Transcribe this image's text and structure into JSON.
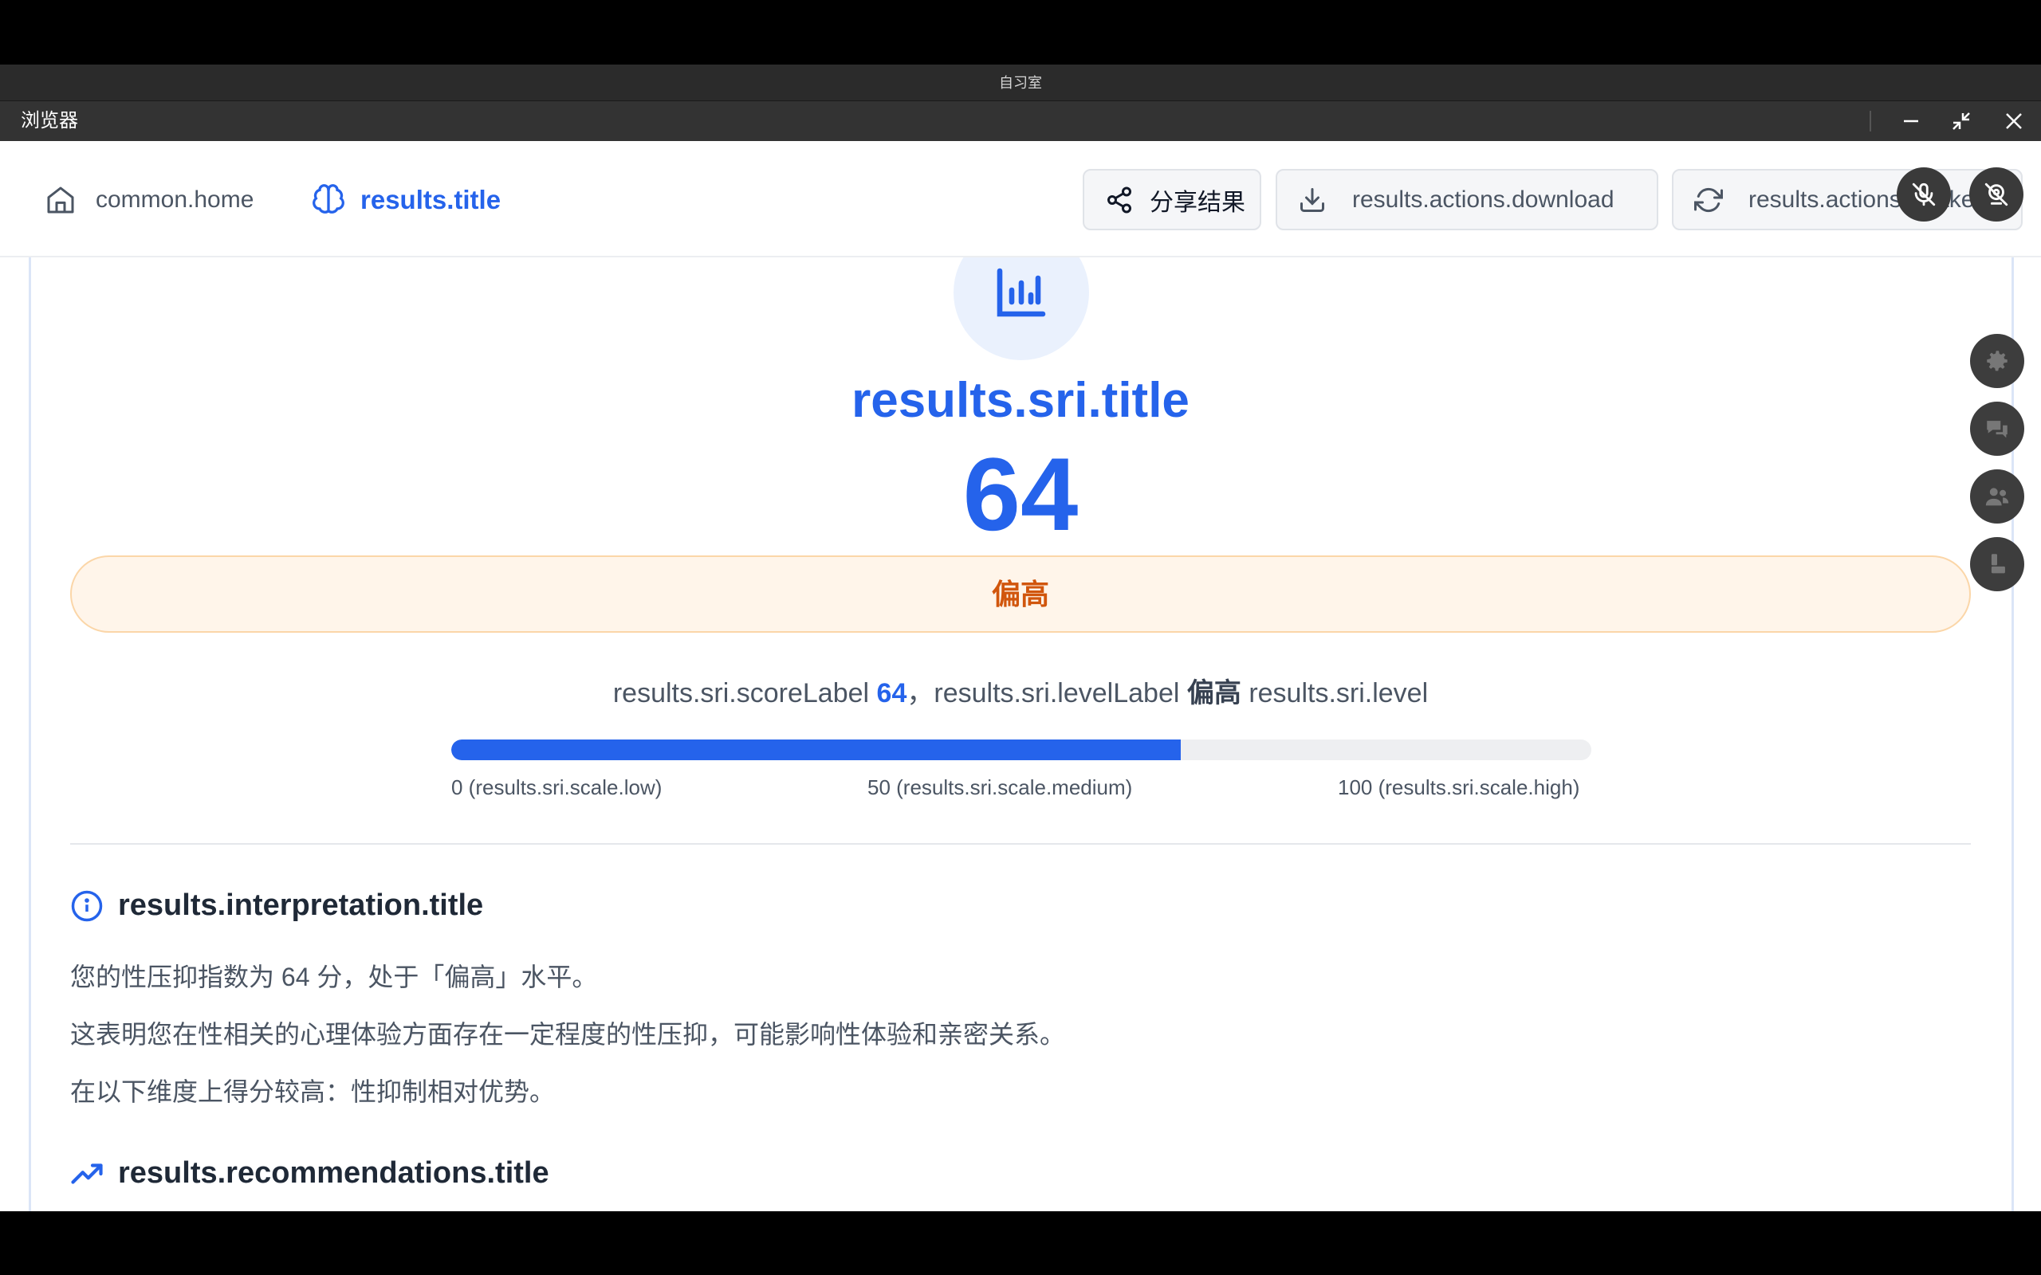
{
  "os": {
    "window_title": "自习室"
  },
  "window": {
    "app_name": "浏览器"
  },
  "nav": {
    "home_label": "common.home",
    "results_label": "results.title",
    "share_label": "分享结果",
    "download_label": "results.actions.download",
    "retake_label": "results.actions.retake"
  },
  "sri": {
    "title": "results.sri.title",
    "score": "64",
    "level": "偏高",
    "score_label": "results.sri.scoreLabel",
    "level_label": "results.sri.levelLabel",
    "level_suffix": "results.sri.level",
    "progress": 0.64,
    "scale_low": "0 (results.sri.scale.low)",
    "scale_medium": "50 (results.sri.scale.medium)",
    "scale_high": "100 (results.sri.scale.high)",
    "comma": "，"
  },
  "interpretation": {
    "title": "results.interpretation.title",
    "paragraphs": [
      "您的性压抑指数为 64 分，处于「偏高」水平。",
      "这表明您在性相关的心理体验方面存在一定程度的性压抑，可能影响性体验和亲密关系。",
      "在以下维度上得分较高：性抑制相对优势。"
    ]
  },
  "recommendations": {
    "title": "results.recommendations.title"
  },
  "translate_badge": {
    "count": "1"
  },
  "colors": {
    "accent": "#2563eb",
    "level": "#d1560d",
    "level_bg": "#fff5ea"
  },
  "icons": [
    "home-icon",
    "brain-icon",
    "share-icon",
    "download-icon",
    "refresh-icon",
    "mic-off-icon",
    "camera-off-icon",
    "bar-chart-icon",
    "info-icon",
    "trending-up-icon",
    "settings-icon",
    "chat-icon",
    "people-icon",
    "person-icon",
    "cursor-icon",
    "minimize-icon",
    "restore-icon",
    "close-icon"
  ]
}
